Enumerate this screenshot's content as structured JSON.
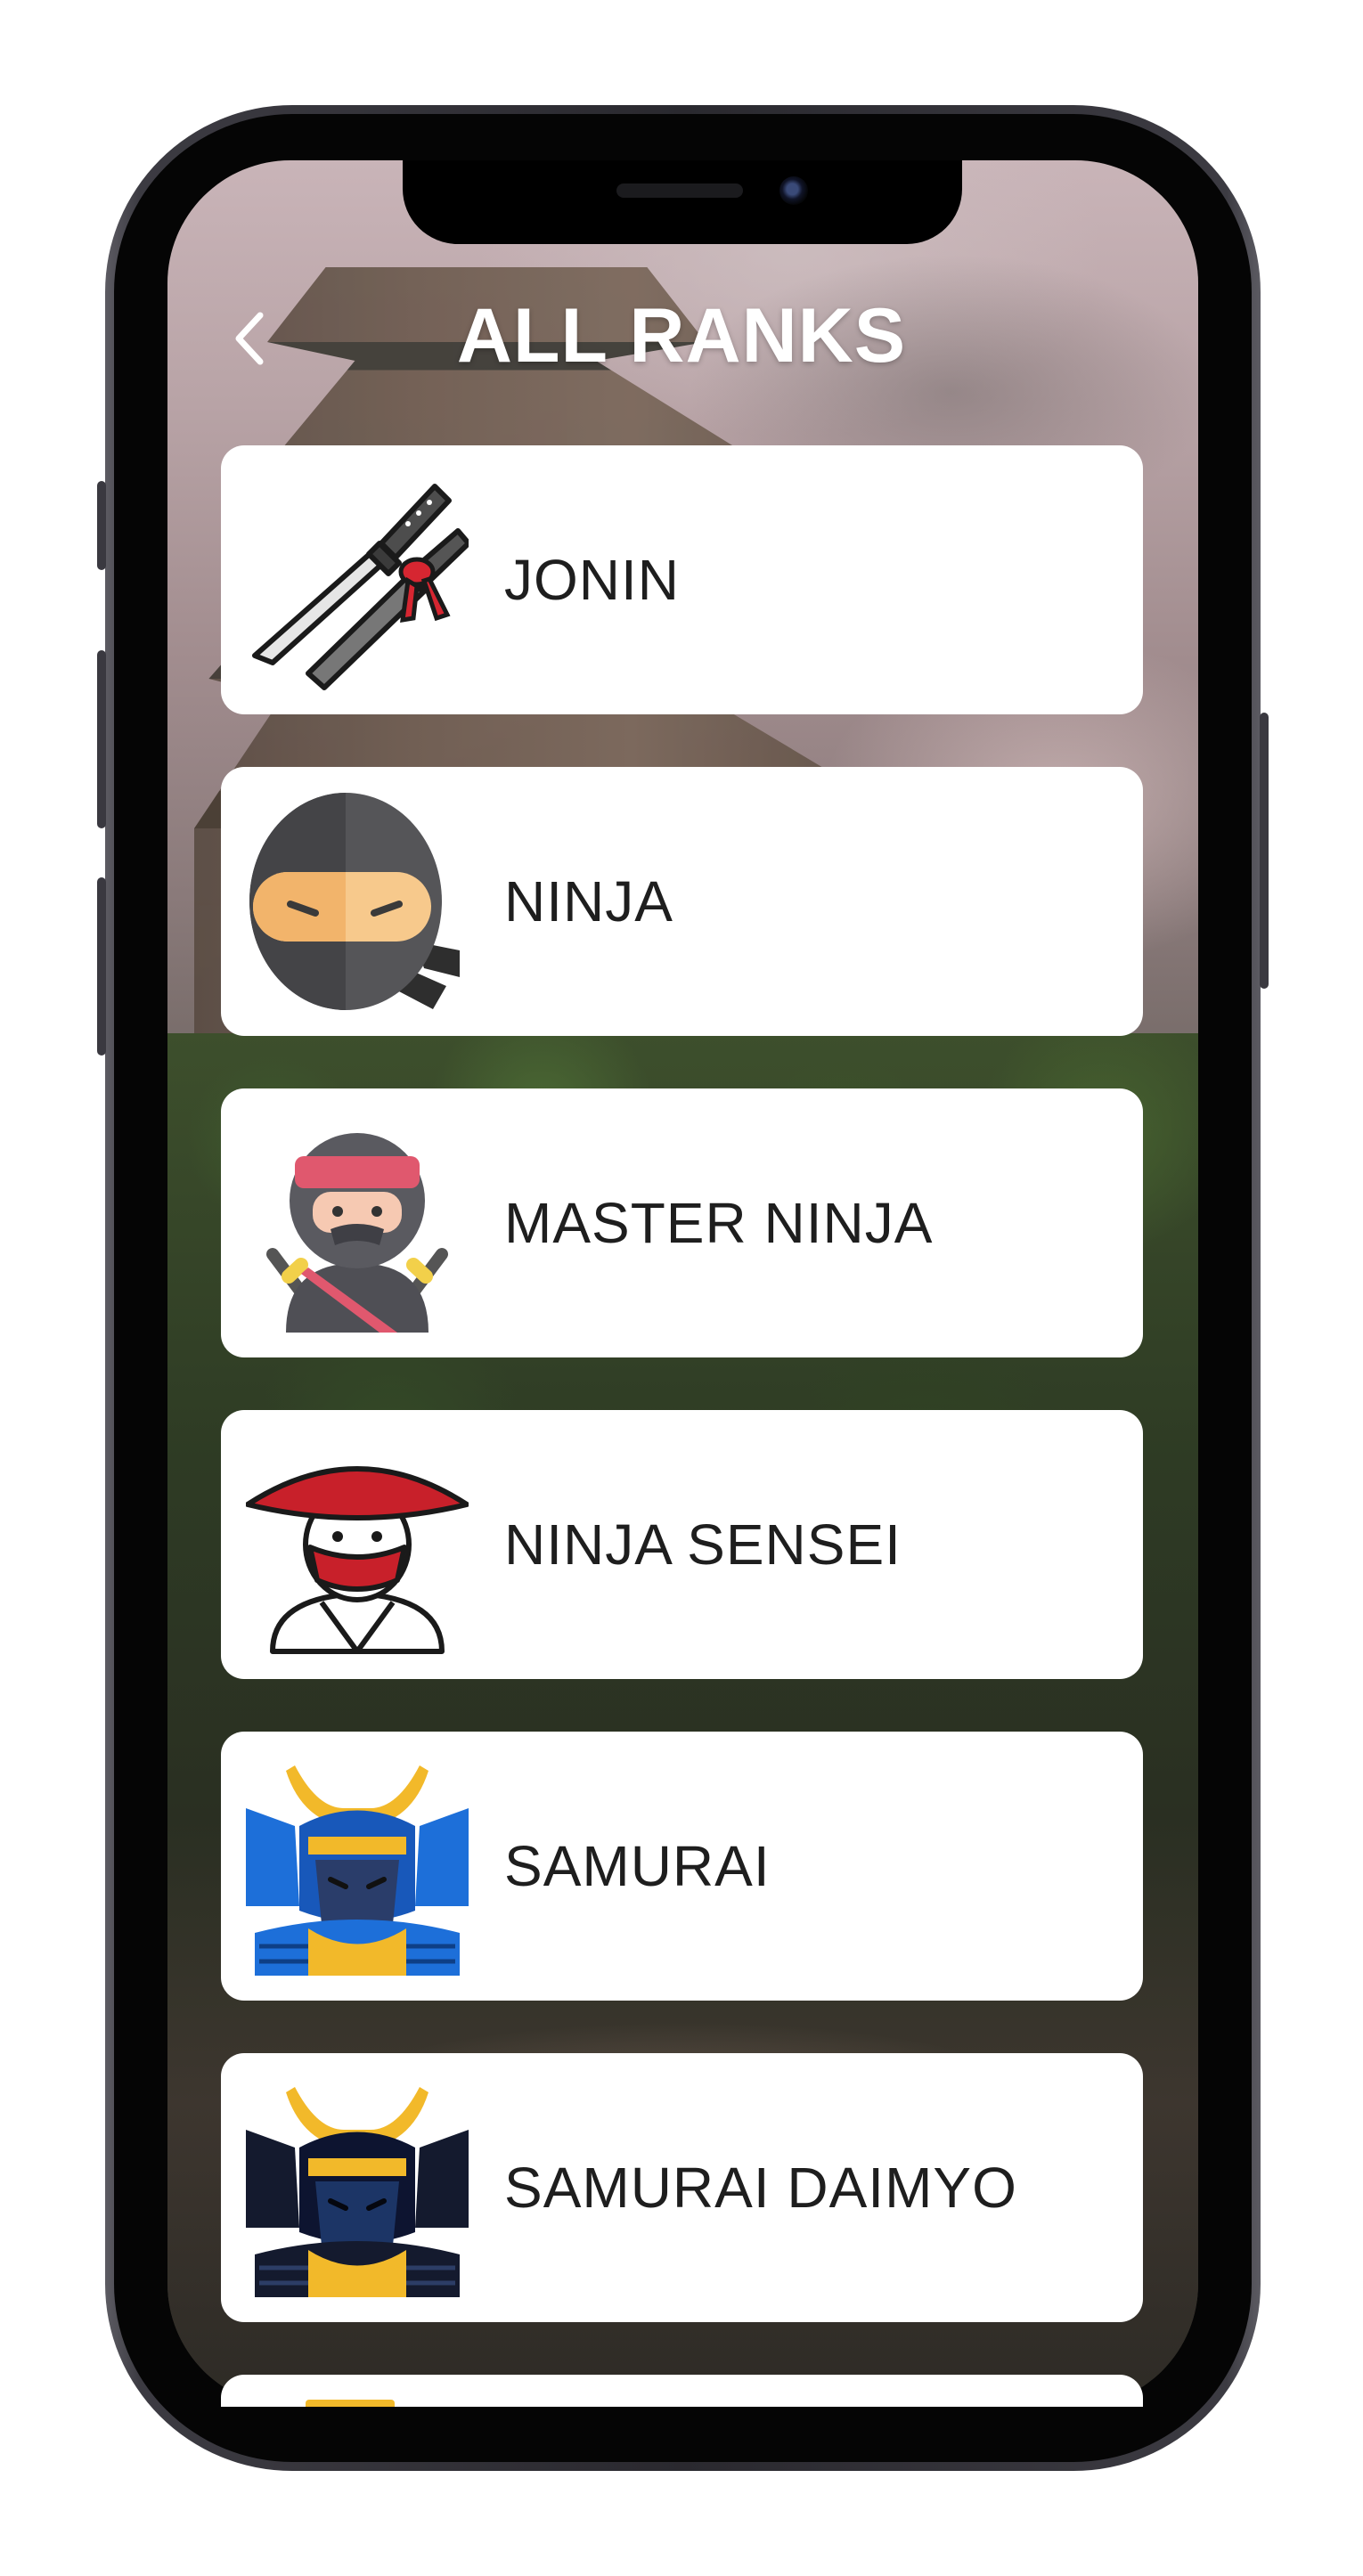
{
  "header": {
    "back_icon": "chevron-left-icon",
    "title": "ALL RANKS"
  },
  "ranks": [
    {
      "label": "JONIN",
      "icon": "crossed-swords-icon"
    },
    {
      "label": "NINJA",
      "icon": "ninja-head-icon"
    },
    {
      "label": "MASTER NINJA",
      "icon": "master-ninja-icon"
    },
    {
      "label": "NINJA SENSEI",
      "icon": "sensei-straw-hat-icon"
    },
    {
      "label": "SAMURAI",
      "icon": "samurai-armor-blue-icon"
    },
    {
      "label": "SAMURAI DAIMYO",
      "icon": "samurai-armor-dark-icon"
    }
  ],
  "colors": {
    "card_background": "#ffffff",
    "label_text": "#1e1e1e",
    "title_text": "#ffffff",
    "sensei_red": "#c8202a",
    "samurai_gold": "#f2b92a",
    "samurai_blue": "#1d6fd9"
  }
}
